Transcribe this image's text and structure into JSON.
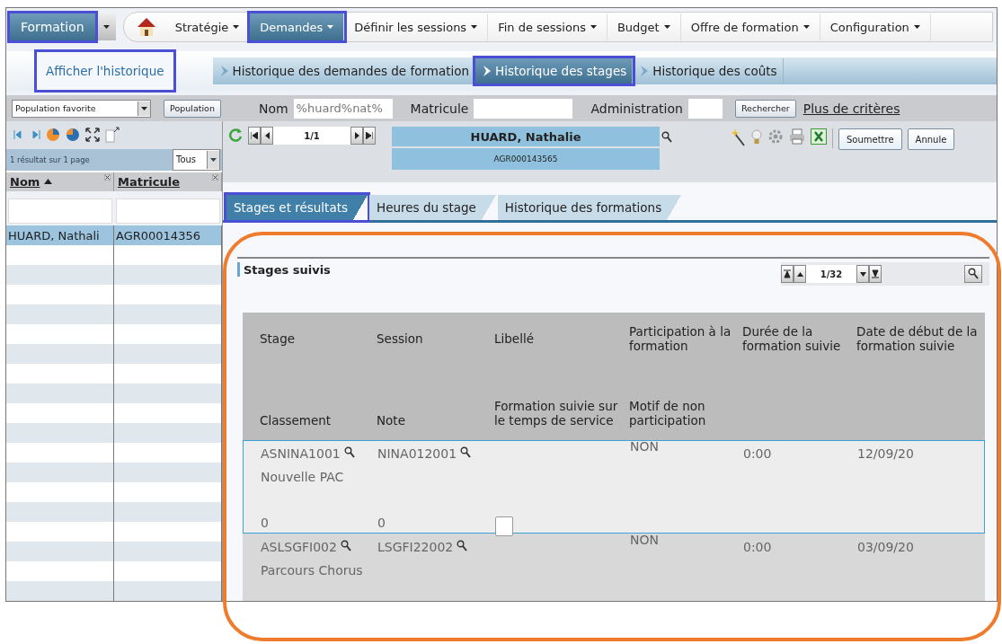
{
  "menu": {
    "module": {
      "label": "Formation",
      "annotated": true
    },
    "items": [
      {
        "label": "Stratégie",
        "selected": false,
        "annotated": false
      },
      {
        "label": "Demandes",
        "selected": true,
        "annotated": true
      },
      {
        "label": "Définir les sessions",
        "selected": false,
        "annotated": false
      },
      {
        "label": "Fin de sessions",
        "selected": false,
        "annotated": false
      },
      {
        "label": "Budget",
        "selected": false,
        "annotated": false
      },
      {
        "label": "Offre de formation",
        "selected": false,
        "annotated": false
      },
      {
        "label": "Configuration",
        "selected": false,
        "annotated": false
      }
    ]
  },
  "subnav": {
    "title": {
      "label": "Afficher l'historique",
      "annotated": true
    },
    "tabs": [
      {
        "label": "Historique des demandes de formation",
        "selected": false,
        "annotated": false
      },
      {
        "label": "Historique des stages",
        "selected": true,
        "annotated": true
      },
      {
        "label": "Historique des coûts",
        "selected": false,
        "annotated": false
      }
    ]
  },
  "search": {
    "population_select": "Population favorite",
    "population_button": "Population",
    "fields": [
      {
        "label": "Nom",
        "value": "%huard%nat%"
      },
      {
        "label": "Matricule"
      },
      {
        "label": "Administration"
      }
    ],
    "search_button": "Rechercher",
    "more_link": "Plus de critères"
  },
  "population_list": {
    "result_count": "1 résultat sur 1 page",
    "filter": "Tous",
    "columns": [
      {
        "label": "Nom",
        "sorted": true
      },
      {
        "label": "Matricule",
        "sorted": false
      }
    ],
    "rows": [
      {
        "name": "HUARD, Nathali",
        "id": "AGR00014356",
        "selected": true
      }
    ]
  },
  "record": {
    "pager": "1/1",
    "name": "HUARD, Nathalie",
    "id": "AGR000143565",
    "buttons": [
      "Soumettre",
      "Annule"
    ]
  },
  "tabs": [
    {
      "label": "Stages et résultats",
      "selected": true,
      "annotated": true
    },
    {
      "label": "Heures du stage",
      "selected": false,
      "annotated": false
    },
    {
      "label": "Historique des formations",
      "selected": false,
      "annotated": false
    }
  ],
  "section": {
    "title": "Stages suivis",
    "pager": "1/32",
    "callout": true,
    "columns": [
      {
        "top": "Stage",
        "bottom": "Classement"
      },
      {
        "top": "Session",
        "bottom": "Note"
      },
      {
        "top": "Libellé",
        "bottom": "Formation suivie sur le temps de service"
      },
      {
        "top": "Participation à la formation",
        "bottom": "Motif de non participation"
      },
      {
        "top": "Durée de la formation suivie"
      },
      {
        "top": "Date de début de la formation suivie"
      }
    ],
    "rows": [
      {
        "stage": "ASNINA1001",
        "stage_label": "Nouvelle PAC",
        "session": "NINA012001",
        "participation": "NON",
        "duration": "0:00",
        "start_date": "12/09/20",
        "classement": "0",
        "note": "0",
        "service_time": false,
        "selected": true
      },
      {
        "stage": "ASLSGFI002",
        "stage_label": "Parcours Chorus",
        "session": "LSGFI22002",
        "participation": "NON",
        "duration": "0:00",
        "start_date": "03/09/20",
        "selected": false
      }
    ]
  }
}
